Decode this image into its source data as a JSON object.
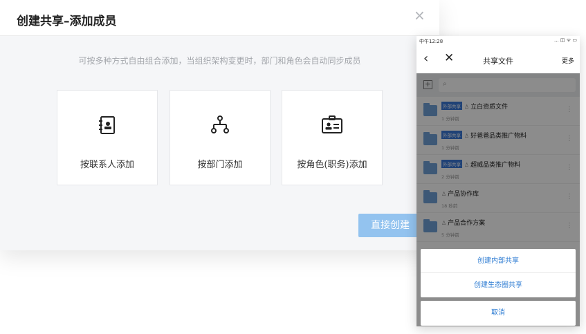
{
  "dialog": {
    "title": "创建共享–添加成员",
    "close_glyph": "×",
    "hint": "可按多种方式自由组合添加，当组织架构变更时，部门和角色会自动同步成员",
    "cards": {
      "contact": {
        "label": "按联系人添加",
        "icon": "contact-book-icon"
      },
      "dept": {
        "label": "按部门添加",
        "icon": "org-tree-icon"
      },
      "role": {
        "label": "按角色(职务)添加",
        "icon": "id-card-icon"
      }
    },
    "direct_button": "直接创建"
  },
  "phone": {
    "status_time": "中午12:28",
    "status_icons": "... ◫ ᯤ ▭",
    "nav": {
      "back": "‹",
      "close": "✕",
      "title": "共享文件",
      "more": "更多"
    },
    "add_glyph": "+",
    "search_icon": "search-icon",
    "files": [
      {
        "badge": "外部共享",
        "name": "立白资质文件",
        "time": "1 分钟前"
      },
      {
        "badge": "外部共享",
        "name": "好爸爸品类推广物料",
        "time": "1 分钟前"
      },
      {
        "badge": "外部共享",
        "name": "超威品类推广物料",
        "time": "2 分钟前"
      },
      {
        "badge": "",
        "name": "产品协作库",
        "time": "18 秒前"
      },
      {
        "badge": "",
        "name": "产品合作方案",
        "time": "5 分钟前"
      }
    ],
    "sheet": {
      "create_internal": "创建内部共享",
      "create_ecosystem": "创建生态圈共享",
      "cancel": "取消"
    }
  },
  "colors": {
    "accent": "#2f7dd3",
    "button": "#93c3ef",
    "badge": "#3b78d8",
    "folder": "#6fa0d8"
  }
}
